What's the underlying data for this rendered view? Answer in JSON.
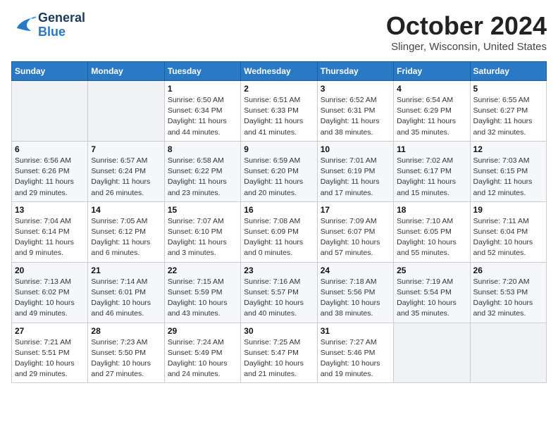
{
  "header": {
    "logo_general": "General",
    "logo_blue": "Blue",
    "month_title": "October 2024",
    "location": "Slinger, Wisconsin, United States"
  },
  "days_of_week": [
    "Sunday",
    "Monday",
    "Tuesday",
    "Wednesday",
    "Thursday",
    "Friday",
    "Saturday"
  ],
  "weeks": [
    [
      {
        "num": "",
        "sunrise": "",
        "sunset": "",
        "daylight": ""
      },
      {
        "num": "",
        "sunrise": "",
        "sunset": "",
        "daylight": ""
      },
      {
        "num": "1",
        "sunrise": "Sunrise: 6:50 AM",
        "sunset": "Sunset: 6:34 PM",
        "daylight": "Daylight: 11 hours and 44 minutes."
      },
      {
        "num": "2",
        "sunrise": "Sunrise: 6:51 AM",
        "sunset": "Sunset: 6:33 PM",
        "daylight": "Daylight: 11 hours and 41 minutes."
      },
      {
        "num": "3",
        "sunrise": "Sunrise: 6:52 AM",
        "sunset": "Sunset: 6:31 PM",
        "daylight": "Daylight: 11 hours and 38 minutes."
      },
      {
        "num": "4",
        "sunrise": "Sunrise: 6:54 AM",
        "sunset": "Sunset: 6:29 PM",
        "daylight": "Daylight: 11 hours and 35 minutes."
      },
      {
        "num": "5",
        "sunrise": "Sunrise: 6:55 AM",
        "sunset": "Sunset: 6:27 PM",
        "daylight": "Daylight: 11 hours and 32 minutes."
      }
    ],
    [
      {
        "num": "6",
        "sunrise": "Sunrise: 6:56 AM",
        "sunset": "Sunset: 6:26 PM",
        "daylight": "Daylight: 11 hours and 29 minutes."
      },
      {
        "num": "7",
        "sunrise": "Sunrise: 6:57 AM",
        "sunset": "Sunset: 6:24 PM",
        "daylight": "Daylight: 11 hours and 26 minutes."
      },
      {
        "num": "8",
        "sunrise": "Sunrise: 6:58 AM",
        "sunset": "Sunset: 6:22 PM",
        "daylight": "Daylight: 11 hours and 23 minutes."
      },
      {
        "num": "9",
        "sunrise": "Sunrise: 6:59 AM",
        "sunset": "Sunset: 6:20 PM",
        "daylight": "Daylight: 11 hours and 20 minutes."
      },
      {
        "num": "10",
        "sunrise": "Sunrise: 7:01 AM",
        "sunset": "Sunset: 6:19 PM",
        "daylight": "Daylight: 11 hours and 17 minutes."
      },
      {
        "num": "11",
        "sunrise": "Sunrise: 7:02 AM",
        "sunset": "Sunset: 6:17 PM",
        "daylight": "Daylight: 11 hours and 15 minutes."
      },
      {
        "num": "12",
        "sunrise": "Sunrise: 7:03 AM",
        "sunset": "Sunset: 6:15 PM",
        "daylight": "Daylight: 11 hours and 12 minutes."
      }
    ],
    [
      {
        "num": "13",
        "sunrise": "Sunrise: 7:04 AM",
        "sunset": "Sunset: 6:14 PM",
        "daylight": "Daylight: 11 hours and 9 minutes."
      },
      {
        "num": "14",
        "sunrise": "Sunrise: 7:05 AM",
        "sunset": "Sunset: 6:12 PM",
        "daylight": "Daylight: 11 hours and 6 minutes."
      },
      {
        "num": "15",
        "sunrise": "Sunrise: 7:07 AM",
        "sunset": "Sunset: 6:10 PM",
        "daylight": "Daylight: 11 hours and 3 minutes."
      },
      {
        "num": "16",
        "sunrise": "Sunrise: 7:08 AM",
        "sunset": "Sunset: 6:09 PM",
        "daylight": "Daylight: 11 hours and 0 minutes."
      },
      {
        "num": "17",
        "sunrise": "Sunrise: 7:09 AM",
        "sunset": "Sunset: 6:07 PM",
        "daylight": "Daylight: 10 hours and 57 minutes."
      },
      {
        "num": "18",
        "sunrise": "Sunrise: 7:10 AM",
        "sunset": "Sunset: 6:05 PM",
        "daylight": "Daylight: 10 hours and 55 minutes."
      },
      {
        "num": "19",
        "sunrise": "Sunrise: 7:11 AM",
        "sunset": "Sunset: 6:04 PM",
        "daylight": "Daylight: 10 hours and 52 minutes."
      }
    ],
    [
      {
        "num": "20",
        "sunrise": "Sunrise: 7:13 AM",
        "sunset": "Sunset: 6:02 PM",
        "daylight": "Daylight: 10 hours and 49 minutes."
      },
      {
        "num": "21",
        "sunrise": "Sunrise: 7:14 AM",
        "sunset": "Sunset: 6:01 PM",
        "daylight": "Daylight: 10 hours and 46 minutes."
      },
      {
        "num": "22",
        "sunrise": "Sunrise: 7:15 AM",
        "sunset": "Sunset: 5:59 PM",
        "daylight": "Daylight: 10 hours and 43 minutes."
      },
      {
        "num": "23",
        "sunrise": "Sunrise: 7:16 AM",
        "sunset": "Sunset: 5:57 PM",
        "daylight": "Daylight: 10 hours and 40 minutes."
      },
      {
        "num": "24",
        "sunrise": "Sunrise: 7:18 AM",
        "sunset": "Sunset: 5:56 PM",
        "daylight": "Daylight: 10 hours and 38 minutes."
      },
      {
        "num": "25",
        "sunrise": "Sunrise: 7:19 AM",
        "sunset": "Sunset: 5:54 PM",
        "daylight": "Daylight: 10 hours and 35 minutes."
      },
      {
        "num": "26",
        "sunrise": "Sunrise: 7:20 AM",
        "sunset": "Sunset: 5:53 PM",
        "daylight": "Daylight: 10 hours and 32 minutes."
      }
    ],
    [
      {
        "num": "27",
        "sunrise": "Sunrise: 7:21 AM",
        "sunset": "Sunset: 5:51 PM",
        "daylight": "Daylight: 10 hours and 29 minutes."
      },
      {
        "num": "28",
        "sunrise": "Sunrise: 7:23 AM",
        "sunset": "Sunset: 5:50 PM",
        "daylight": "Daylight: 10 hours and 27 minutes."
      },
      {
        "num": "29",
        "sunrise": "Sunrise: 7:24 AM",
        "sunset": "Sunset: 5:49 PM",
        "daylight": "Daylight: 10 hours and 24 minutes."
      },
      {
        "num": "30",
        "sunrise": "Sunrise: 7:25 AM",
        "sunset": "Sunset: 5:47 PM",
        "daylight": "Daylight: 10 hours and 21 minutes."
      },
      {
        "num": "31",
        "sunrise": "Sunrise: 7:27 AM",
        "sunset": "Sunset: 5:46 PM",
        "daylight": "Daylight: 10 hours and 19 minutes."
      },
      {
        "num": "",
        "sunrise": "",
        "sunset": "",
        "daylight": ""
      },
      {
        "num": "",
        "sunrise": "",
        "sunset": "",
        "daylight": ""
      }
    ]
  ]
}
